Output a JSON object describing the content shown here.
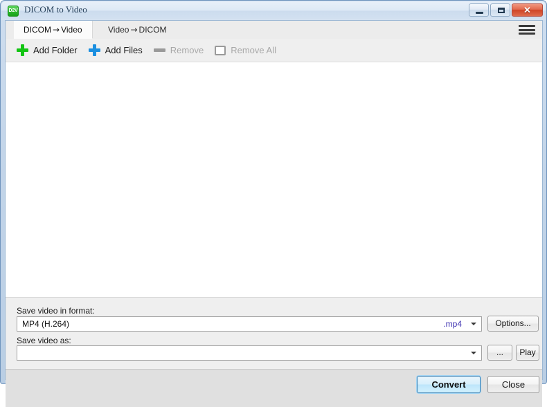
{
  "window": {
    "title": "DICOM to Video",
    "icon_label": "D2V",
    "icon_name": "app-icon-d2v",
    "controls": {
      "minimize": "minimize-icon",
      "maximize": "maximize-icon",
      "close": "✕"
    },
    "accent_blue": "#3c7fb1",
    "frame_blue": "#9cb8d4"
  },
  "tabs": [
    {
      "label_left": "DICOM",
      "arrow": "→",
      "label_right": "Video",
      "active": true
    },
    {
      "label_left": "Video",
      "arrow": "→",
      "label_right": "DICOM",
      "active": false
    }
  ],
  "menu": {
    "name": "hamburger-menu",
    "label": "Menu"
  },
  "toolbar": {
    "items": [
      {
        "label": "Add Folder",
        "icon": "plus-icon",
        "color": "#13c413",
        "enabled": true
      },
      {
        "label": "Add Files",
        "icon": "plus-icon",
        "color": "#1b8fe0",
        "enabled": true
      },
      {
        "label": "Remove",
        "icon": "dash-icon",
        "color": "#9a9a9a",
        "enabled": false
      },
      {
        "label": "Remove All",
        "icon": "square-outline-icon",
        "color": "#9a9a9a",
        "enabled": false
      }
    ]
  },
  "file_list": {
    "items": [],
    "empty": true
  },
  "options": {
    "format_label": "Save video in format:",
    "format_value": "MP4 (H.264)",
    "format_extension": ".mp4",
    "options_button": "Options...",
    "saveas_label": "Save video as:",
    "saveas_value": "",
    "browse_button": "...",
    "play_button": "Play"
  },
  "footer": {
    "convert_button": "Convert",
    "close_button": "Close"
  }
}
